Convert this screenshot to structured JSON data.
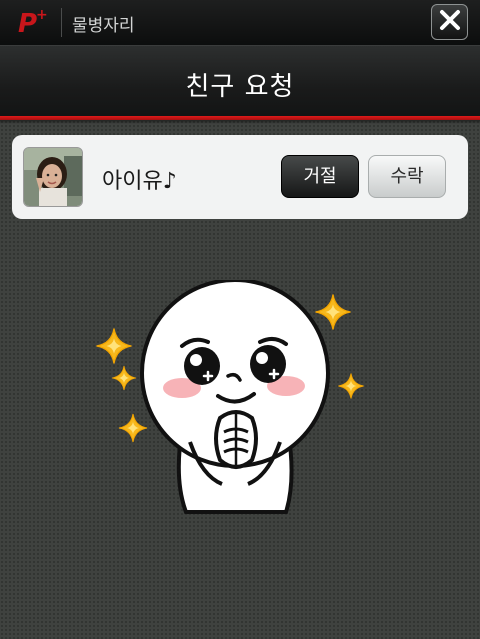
{
  "header": {
    "app_name": "물병자리",
    "logo": "p-plus-logo-icon",
    "close_icon": "close-icon"
  },
  "title": "친구 요청",
  "request": {
    "friend_name": "아이유♪",
    "avatar": "friend-avatar-photo",
    "reject_label": "거절",
    "accept_label": "수락"
  },
  "sticker": "moon-character-pleading-sticker",
  "colors": {
    "accent_red": "#d81818",
    "background": "#3f423f",
    "card": "#f2f3f3"
  }
}
